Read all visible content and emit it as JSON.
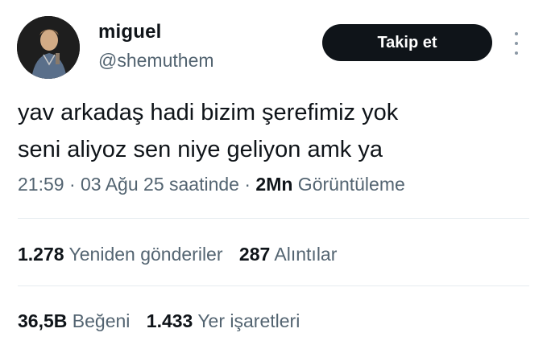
{
  "author": {
    "display_name": "miguel",
    "handle": "@shemuthem"
  },
  "follow_button": {
    "label": "Takip et"
  },
  "tweet": {
    "lines": [
      "yav arkadaş hadi bizim şerefimiz yok",
      "seni aliyoz sen niye geliyon amk ya"
    ]
  },
  "meta": {
    "time": "21:59",
    "separator1": " · ",
    "date": "03 Ağu 25 saatinde",
    "separator2": " · ",
    "views_count": "2Mn",
    "views_label": " Görüntüleme"
  },
  "stats": {
    "retweets": {
      "count": "1.278",
      "label": " Yeniden gönderiler"
    },
    "quotes": {
      "count": "287",
      "label": " Alıntılar"
    },
    "likes": {
      "count": "36,5B",
      "label": " Beğeni"
    },
    "bookmarks": {
      "count": "1.433",
      "label": " Yer işaretleri"
    }
  },
  "icons": {
    "more": "more-vertical-icon"
  }
}
